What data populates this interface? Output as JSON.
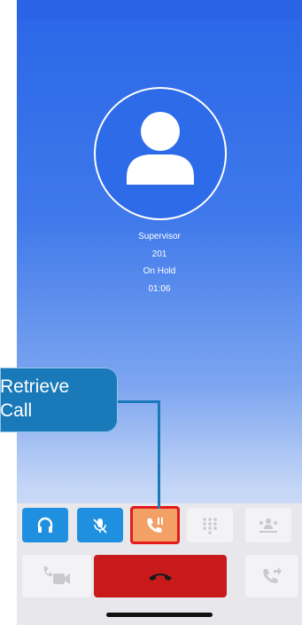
{
  "call": {
    "name": "Supervisor",
    "extension": "201",
    "status": "On Hold",
    "timer": "01:06"
  },
  "callout": {
    "text": "Retrieve\nCall"
  },
  "controls": {
    "row1": [
      "headset-icon",
      "mute-icon",
      "retrieve-call-icon",
      "dialpad-icon",
      "conference-icon"
    ],
    "row2": [
      "video-icon",
      "end-call-icon",
      "transfer-icon"
    ]
  },
  "colors": {
    "accent_blue": "#1f8fe0",
    "highlight_orange": "#f2a066",
    "highlight_border": "#e31b1b",
    "end_call_red": "#c81a1a",
    "callout_blue": "#1a79b8"
  }
}
